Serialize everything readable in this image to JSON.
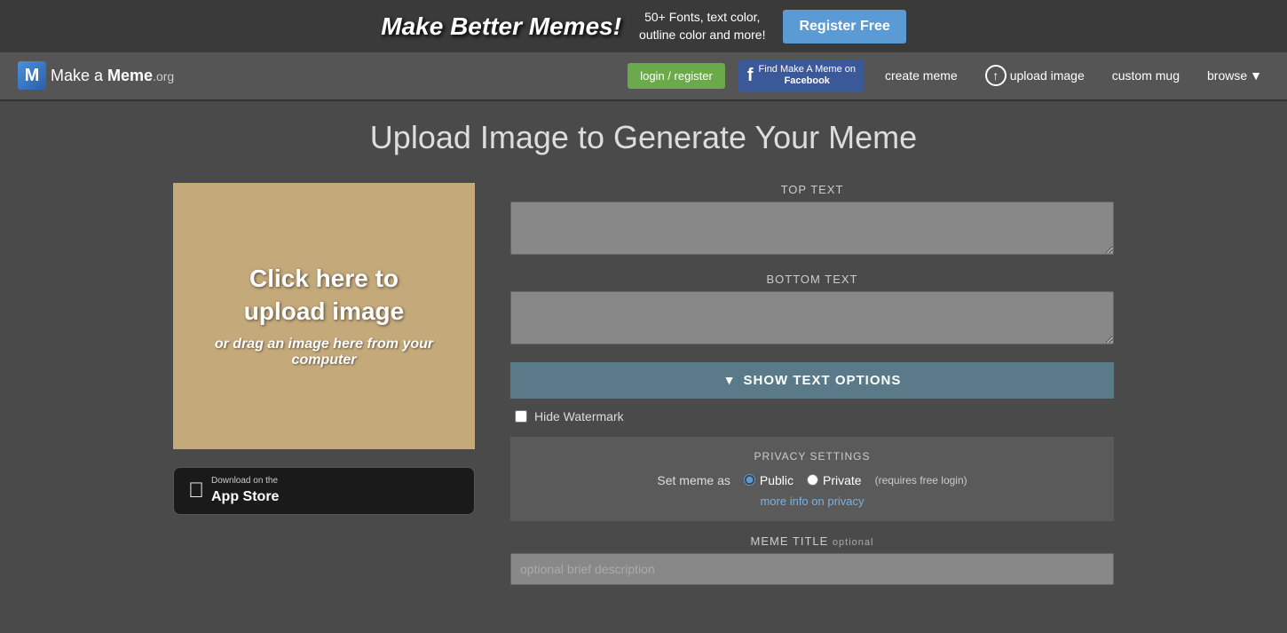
{
  "banner": {
    "title": "Make Better Memes!",
    "subtitle": "50+ Fonts, text color,\noutline color and more!",
    "register_label": "Register Free"
  },
  "navbar": {
    "logo_letter": "M",
    "logo_make": "Make a ",
    "logo_meme": "Meme",
    "logo_org": ".org",
    "login_label": "login / register",
    "fb_find": "Find Make A Meme on",
    "fb_name": "Facebook",
    "create_label": "create meme",
    "upload_label": "upload image",
    "custom_label": "custom mug",
    "browse_label": "browse",
    "browse_arrow": "▼"
  },
  "page": {
    "title": "Upload Image to Generate Your Meme"
  },
  "upload_box": {
    "main_text": "Click here to\nupload image",
    "sub_text": "or drag an image here from\nyour computer"
  },
  "app_store": {
    "download_on": "Download on the",
    "store_name": "App Store"
  },
  "form": {
    "top_text_label": "TOP TEXT",
    "top_text_placeholder": "",
    "bottom_text_label": "BOTTOM TEXT",
    "bottom_text_placeholder": "",
    "show_options_label": "SHOW TEXT OPTIONS",
    "watermark_label": "Hide Watermark",
    "privacy_title": "PRIVACY SETTINGS",
    "set_meme_label": "Set meme as",
    "public_label": "Public",
    "private_label": "Private",
    "requires_text": "(requires free login)",
    "privacy_link": "more info on privacy",
    "meme_title_label": "MEME TITLE",
    "optional_label": "OPTIONAL",
    "title_placeholder": "optional brief description"
  }
}
